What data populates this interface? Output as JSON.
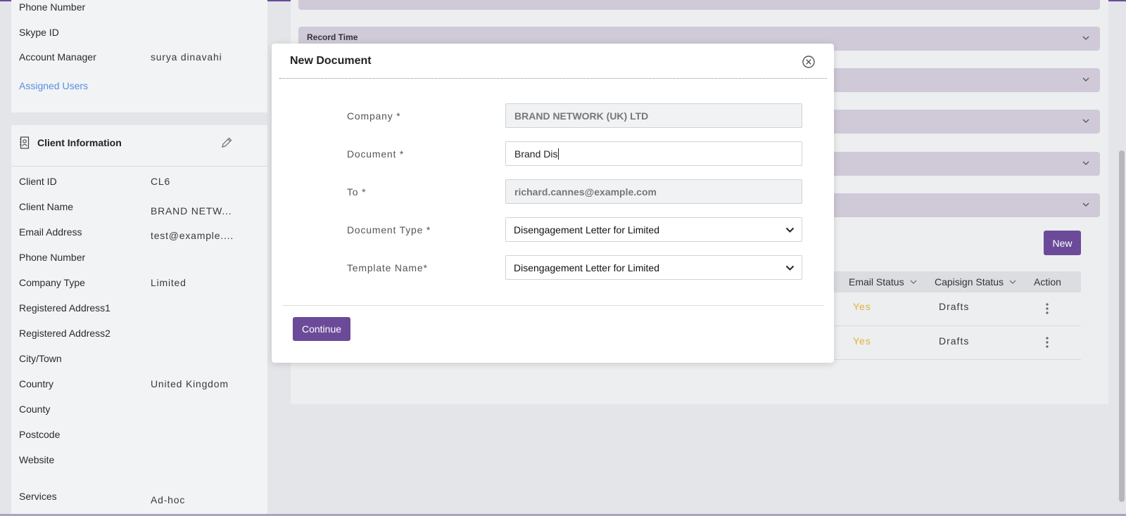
{
  "account": {
    "rows": [
      {
        "label": "Phone Number",
        "value": ""
      },
      {
        "label": "Skype ID",
        "value": ""
      },
      {
        "label": "Account Manager",
        "value": "surya dinavahi"
      }
    ],
    "assigned_users_link": "Assigned Users"
  },
  "client_info": {
    "title": "Client Information",
    "icon": "contact-card-icon",
    "edit_icon": "pencil-icon",
    "rows": [
      {
        "label": "Client ID",
        "value": "CL6"
      },
      {
        "label": "Client Name",
        "value": "BRAND NETW..."
      },
      {
        "label": "Email Address",
        "value": "test@example...."
      },
      {
        "label": "Phone Number",
        "value": ""
      },
      {
        "label": "Company Type",
        "value": "Limited"
      },
      {
        "label": "Registered Address1",
        "value": ""
      },
      {
        "label": "Registered Address2",
        "value": ""
      },
      {
        "label": "City/Town",
        "value": ""
      },
      {
        "label": "Country",
        "value": "United Kingdom"
      },
      {
        "label": "County",
        "value": ""
      },
      {
        "label": "Postcode",
        "value": ""
      },
      {
        "label": "Website",
        "value": ""
      },
      {
        "label": "Services",
        "value": "Ad-hoc"
      }
    ]
  },
  "accordions": [
    {
      "title": ""
    },
    {
      "title": "Record Time"
    },
    {
      "title": ""
    },
    {
      "title": ""
    },
    {
      "title": ""
    },
    {
      "title": ""
    }
  ],
  "documents": {
    "new_button": "New",
    "columns": [
      "Email Status",
      "Capisign Status",
      "Action"
    ],
    "rows": [
      {
        "email_status": "Yes",
        "capisign_status": "Drafts"
      },
      {
        "email_status": "Yes",
        "capisign_status": "Drafts"
      }
    ]
  },
  "modal": {
    "title": "New Document",
    "close_icon": "close-circle-icon",
    "fields": {
      "company": {
        "label": "Company *",
        "value": "BRAND NETWORK (UK) LTD"
      },
      "document": {
        "label": "Document *",
        "value": "Brand Dis"
      },
      "to": {
        "label": "To *",
        "value": "richard.cannes@example.com"
      },
      "document_type": {
        "label": "Document Type *",
        "value": "Disengagement Letter for Limited"
      },
      "template_name": {
        "label": "Template Name*",
        "value": "Disengagement Letter for Limited"
      }
    },
    "continue_button": "Continue"
  },
  "colors": {
    "accent": "#6b4b99",
    "accordion": "#cfc9d8",
    "yes_status": "#e0b43a",
    "link": "#5a8ee0"
  }
}
